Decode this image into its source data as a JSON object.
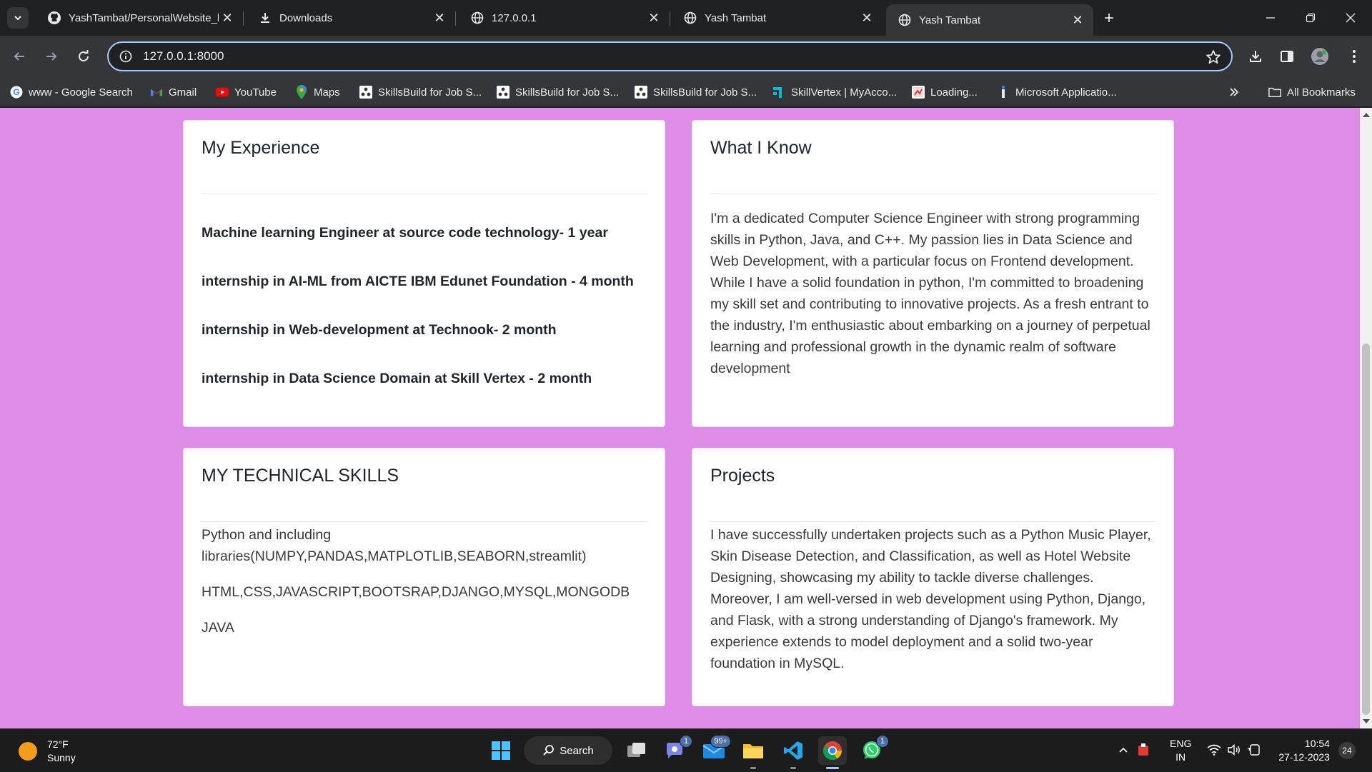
{
  "browser": {
    "tabs": [
      {
        "title": "YashTambat/PersonalWebsite_b",
        "icon": "github-icon"
      },
      {
        "title": "Downloads",
        "icon": "download-icon"
      },
      {
        "title": "127.0.0.1",
        "icon": "globe-icon"
      },
      {
        "title": "Yash Tambat",
        "icon": "globe-icon"
      },
      {
        "title": "Yash Tambat",
        "icon": "globe-icon",
        "active": true
      }
    ],
    "url": "127.0.0.1:8000",
    "bookmarks": [
      {
        "label": "www - Google Search",
        "icon": "google-icon"
      },
      {
        "label": "Gmail",
        "icon": "gmail-icon"
      },
      {
        "label": "YouTube",
        "icon": "youtube-icon"
      },
      {
        "label": "Maps",
        "icon": "maps-icon"
      },
      {
        "label": "SkillsBuild for Job S...",
        "icon": "skillsbuild-icon"
      },
      {
        "label": "SkillsBuild for Job S...",
        "icon": "skillsbuild-icon"
      },
      {
        "label": "SkillsBuild for Job S...",
        "icon": "skillsbuild-icon"
      },
      {
        "label": "SkillVertex | MyAcco...",
        "icon": "skillvertex-icon"
      },
      {
        "label": "Loading...",
        "icon": "loading-icon"
      },
      {
        "label": "Microsoft Applicatio...",
        "icon": "microsoft-icon"
      }
    ],
    "all_bookmarks_label": "All Bookmarks"
  },
  "page": {
    "experience": {
      "title": "My Experience",
      "items": [
        "Machine learning Engineer at source code technology- 1 year",
        "internship in AI-ML from AICTE IBM Edunet Foundation - 4 month",
        "internship in Web-development at Technook- 2 month",
        "internship in Data Science Domain at Skill Vertex - 2 month"
      ]
    },
    "know": {
      "title": "What I Know",
      "text": "I'm a dedicated Computer Science Engineer with strong programming skills in Python, Java, and C++. My passion lies in Data Science and Web Development, with a particular focus on Frontend development. While I have a solid foundation in python, I'm committed to broadening my skill set and contributing to innovative projects. As a fresh entrant to the industry, I'm enthusiastic about embarking on a journey of perpetual learning and professional growth in the dynamic realm of software development"
    },
    "skills": {
      "title": "MY TECHNICAL SKILLS",
      "items": [
        "Python and including libraries(NUMPY,PANDAS,MATPLOTLIB,SEABORN,streamlit)",
        "HTML,CSS,JAVASCRIPT,BOOTSRAP,DJANGO,MYSQL,MONGODB",
        "JAVA"
      ]
    },
    "projects": {
      "title": "Projects",
      "text": "I have successfully undertaken projects such as a Python Music Player, Skin Disease Detection, and Classification, as well as Hotel Website Designing, showcasing my ability to tackle diverse challenges. Moreover, I am well-versed in web development using Python, Django, and Flask, with a strong understanding of Django's framework. My experience extends to model deployment and a solid two-year foundation in MySQL."
    }
  },
  "taskbar": {
    "weather": {
      "temp": "72°F",
      "condition": "Sunny"
    },
    "search_label": "Search",
    "badges": {
      "teams": "1",
      "mail": "99+",
      "whatsapp": "1"
    },
    "language": {
      "line1": "ENG",
      "line2": "IN"
    },
    "time": "10:54",
    "date": "27-12-2023",
    "notifications": "24"
  }
}
